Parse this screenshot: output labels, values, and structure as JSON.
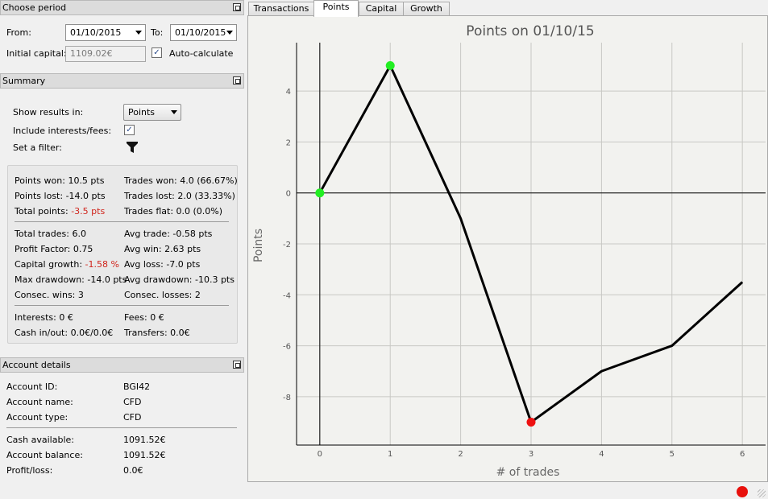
{
  "period": {
    "title": "Choose period",
    "from_label": "From:",
    "from_value": "01/10/2015",
    "to_label": "To:",
    "to_value": "01/10/2015",
    "capital_label": "Initial capital:",
    "capital_value": "1109.02€",
    "autocalc_label": "Auto-calculate",
    "autocalc_checked": true
  },
  "summary": {
    "title": "Summary",
    "show_results_label": "Show results in:",
    "show_results_value": "Points",
    "include_label": "Include interests/fees:",
    "include_checked": true,
    "filter_label": "Set a filter:",
    "stats": {
      "points_won": "Points won: 10.5 pts",
      "trades_won": "Trades won: 4.0 (66.67%)",
      "points_lost": "Points lost: -14.0 pts",
      "trades_lost": "Trades lost: 2.0 (33.33%)",
      "total_points_label": "Total points: ",
      "total_points_value": "-3.5 pts",
      "trades_flat": "Trades flat: 0.0 (0.0%)",
      "total_trades": "Total trades: 6.0",
      "avg_trade": "Avg trade: -0.58 pts",
      "profit_factor": "Profit Factor: 0.75",
      "avg_win": "Avg win: 2.63 pts",
      "capital_growth_label": "Capital growth: ",
      "capital_growth_value": "-1.58 %",
      "avg_loss": "Avg loss: -7.0 pts",
      "max_drawdown": "Max drawdown: -14.0 pts",
      "avg_drawdown": "Avg drawdown: -10.3 pts",
      "consec_wins": "Consec. wins: 3",
      "consec_losses": "Consec. losses: 2",
      "interests": "Interests: 0 €",
      "fees": "Fees: 0 €",
      "cash_inout": "Cash in/out: 0.0€/0.0€",
      "transfers": "Transfers: 0.0€"
    }
  },
  "account": {
    "title": "Account details",
    "id_label": "Account ID:",
    "id_value": "BGI42",
    "name_label": "Account name:",
    "name_value": "CFD",
    "type_label": "Account type:",
    "type_value": "CFD",
    "cash_label": "Cash available:",
    "cash_value": "1091.52€",
    "balance_label": "Account balance:",
    "balance_value": "1091.52€",
    "pl_label": "Profit/loss:",
    "pl_value": "0.0€"
  },
  "tabs": [
    "Transactions",
    "Points",
    "Capital",
    "Growth"
  ],
  "active_tab": "Points",
  "status": {
    "indicator_color": "#e8100c"
  },
  "chart_data": {
    "type": "line",
    "title": "Points on 01/10/15",
    "xlabel": "# of trades",
    "ylabel": "Points",
    "x": [
      0,
      1,
      2,
      3,
      4,
      5,
      6
    ],
    "values": [
      0,
      5,
      -1,
      -9,
      -7,
      -6,
      -3.5
    ],
    "xlim": [
      -0.33,
      6.33
    ],
    "ylim": [
      -9.9,
      5.9
    ],
    "xticks": [
      0,
      1,
      2,
      3,
      4,
      5,
      6
    ],
    "yticks": [
      -8,
      -6,
      -4,
      -2,
      0,
      2,
      4
    ],
    "grid": true,
    "line_color": "#000000",
    "markers": [
      {
        "x": 0,
        "y": 0,
        "color": "#22ee22"
      },
      {
        "x": 1,
        "y": 5,
        "color": "#22ee22"
      },
      {
        "x": 3,
        "y": -9,
        "color": "#ee1111"
      }
    ]
  }
}
